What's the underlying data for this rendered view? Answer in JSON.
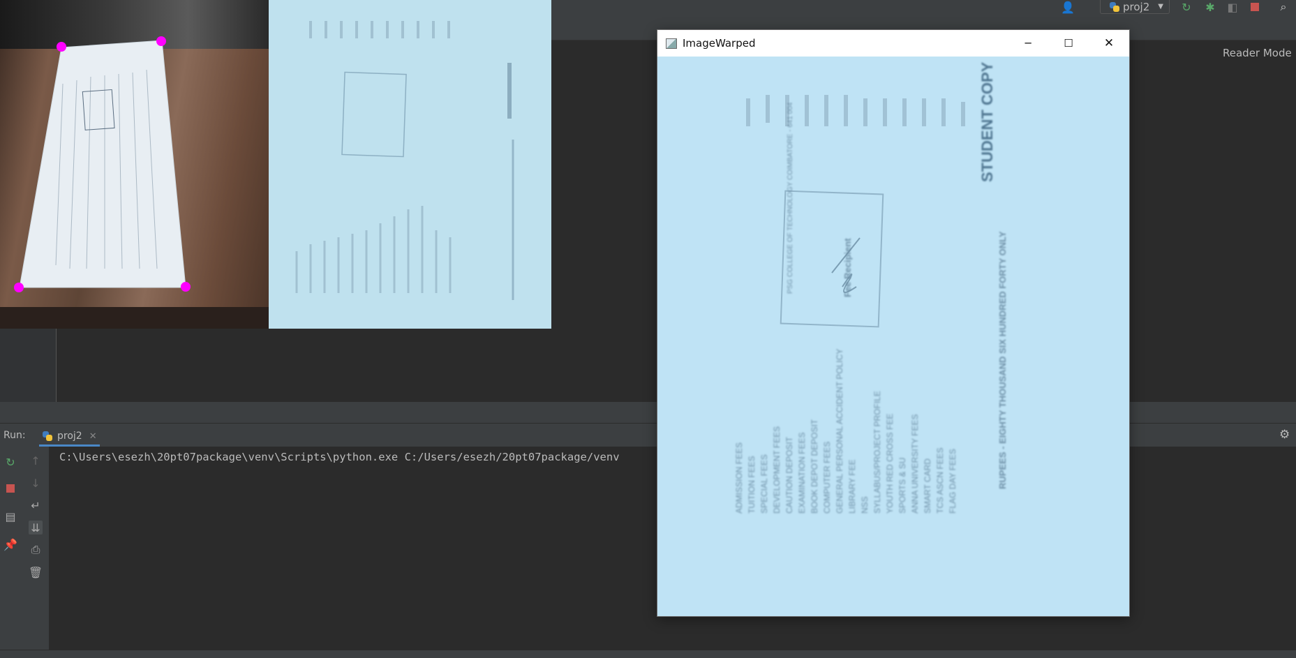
{
  "window_title": "ImageWarped",
  "toolbar": {
    "project_combo": "proj2",
    "reader_mode": "Reader Mode"
  },
  "run_panel": {
    "label": "Run:",
    "tab_label": "proj2",
    "console_line": "C:\\Users\\esezh\\20pt07package\\venv\\Scripts\\python.exe C:/Users/esezh/20pt07package/venv"
  },
  "document_text": {
    "heading_vertical": "STUDENT COPY",
    "amount_words": "RUPEES - EIGHTY THOUSAND SIX HUNDRED FORTY ONLY",
    "fee_items": [
      "ADMISSION FEES",
      "TUITION FEES",
      "SPECIAL FEES",
      "DEVELOPMENT FEES",
      "CAUTION DEPOSIT",
      "EXAMINATION FEES",
      "BOOK DEPOT DEPOSIT",
      "COMPUTER FEES",
      "GENERAL PERSONAL ACCIDENT POLICY",
      "LIBRARY FEE",
      "NSS",
      "SYLLABUS/PROJECT PROFILE",
      "YOUTH RED CROSS FEE",
      "SPORTS & SU",
      "ANNA UNIVERSITY FEES",
      "SMART CARD",
      "TCS ASCN FEES",
      "FLAG DAY FEES"
    ],
    "stamp_text": "PSG COLLEGE OF TECHNOLOGY COIMBATORE - 641 004",
    "stamp_sign": "Fee Recipient"
  },
  "colors": {
    "ide_bg": "#2b2b2b",
    "panel_bg": "#3c3f41",
    "warped_bg": "#bfe3f5",
    "marker": "#ff00ff"
  }
}
